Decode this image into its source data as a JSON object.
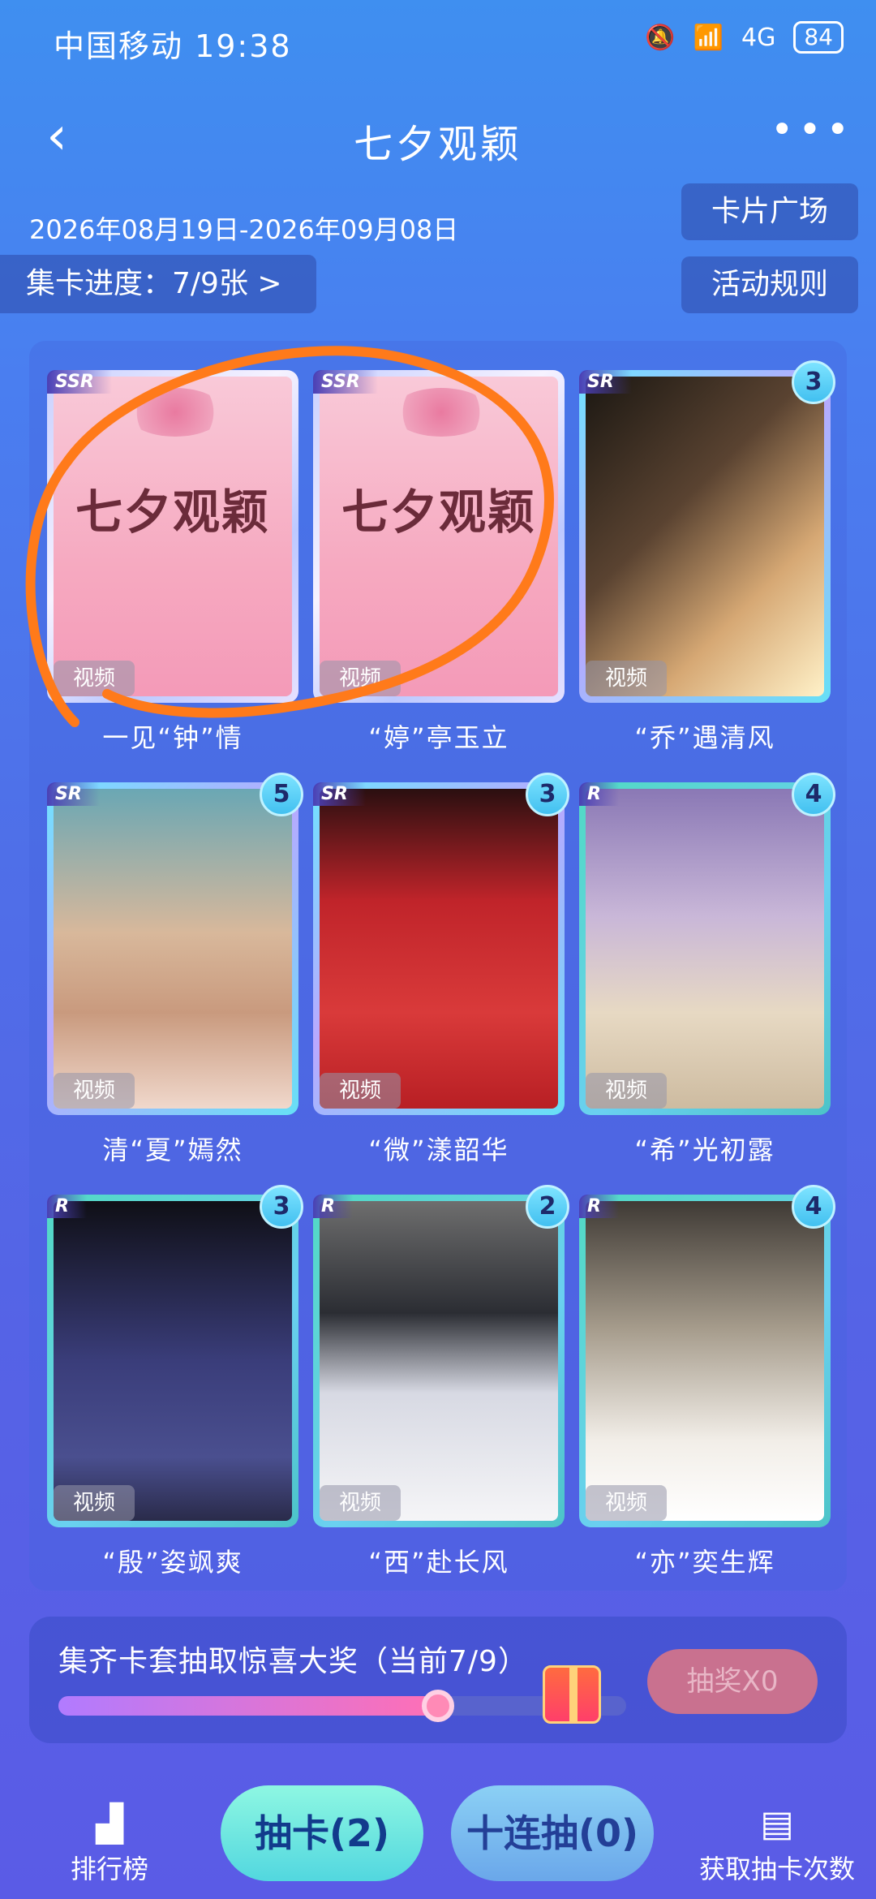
{
  "status_bar": {
    "carrier_time": "中国移动 19:38",
    "network": "4G",
    "battery": "84"
  },
  "header": {
    "title": "七夕观颖",
    "back_icon": "chevron-left-icon",
    "more_label": "•••"
  },
  "event": {
    "date_range": "2026年08月19日-2026年09月08日",
    "progress_label": "集卡进度：7/9张 >",
    "card_square_label": "卡片广场",
    "rules_label": "活动规则"
  },
  "cards": [
    {
      "name": "一见“钟”情",
      "rarity": "SSR",
      "tag": "视频",
      "count": "",
      "poster_title": "七夕观颖"
    },
    {
      "name": "“婷”亭玉立",
      "rarity": "SSR",
      "tag": "视频",
      "count": "",
      "poster_title": "七夕观颖"
    },
    {
      "name": "“乔”遇清风",
      "rarity": "SR",
      "tag": "视频",
      "count": "3"
    },
    {
      "name": "清“夏”嫣然",
      "rarity": "SR",
      "tag": "视频",
      "count": "5"
    },
    {
      "name": "“微”漾韶华",
      "rarity": "SR",
      "tag": "视频",
      "count": "3"
    },
    {
      "name": "“希”光初露",
      "rarity": "R",
      "tag": "视频",
      "count": "4"
    },
    {
      "name": "“殷”姿飒爽",
      "rarity": "R",
      "tag": "视频",
      "count": "3"
    },
    {
      "name": "“西”赴长风",
      "rarity": "R",
      "tag": "视频",
      "count": "2"
    },
    {
      "name": "“亦”奕生辉",
      "rarity": "R",
      "tag": "视频",
      "count": "4"
    }
  ],
  "prize": {
    "text": "集齐卡套抽取惊喜大奖（当前7/9）",
    "progress_fraction": 0.7778,
    "draw_prize_label": "抽奖X0"
  },
  "bottom_bar": {
    "rank_label": "排行榜",
    "draw_label": "抽卡(2)",
    "ten_draw_label": "十连抽(0)",
    "get_chances_label": "获取抽卡次数"
  },
  "colors": {
    "annotation": "#ff7a1a",
    "accent_teal": "#52d7df"
  }
}
